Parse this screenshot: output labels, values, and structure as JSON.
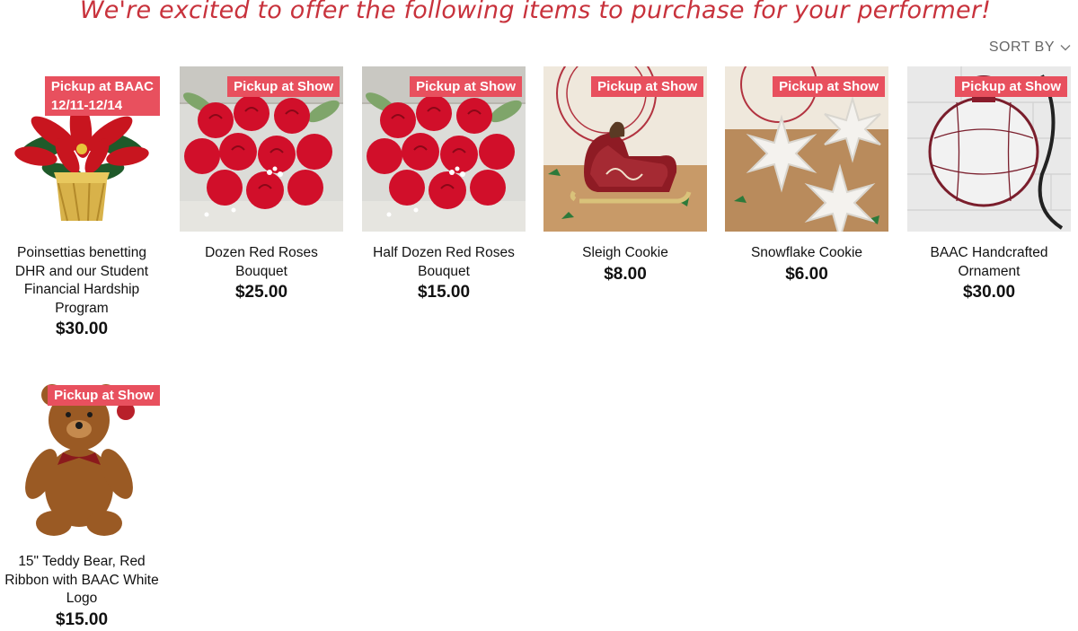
{
  "header": {
    "headline": "We're excited to offer the following items to purchase for your performer!",
    "sort_label": "SORT BY"
  },
  "products": [
    {
      "name": "Poinsettias benetting DHR and our Student Financial Hardship Program",
      "price": "$30.00",
      "badge_line1": "Pickup at BAAC",
      "badge_line2": "12/11-12/14",
      "image": "poinsettia"
    },
    {
      "name": "Dozen Red Roses Bouquet",
      "price": "$25.00",
      "badge_line1": "Pickup at Show",
      "image": "roses"
    },
    {
      "name": "Half Dozen Red Roses Bouquet",
      "price": "$15.00",
      "badge_line1": "Pickup at Show",
      "image": "roses"
    },
    {
      "name": "Sleigh Cookie",
      "price": "$8.00",
      "badge_line1": "Pickup at Show",
      "image": "sleigh-cookie"
    },
    {
      "name": "Snowflake Cookie",
      "price": "$6.00",
      "badge_line1": "Pickup at Show",
      "image": "snowflake-cookie"
    },
    {
      "name": "BAAC Handcrafted Ornament",
      "price": "$30.00",
      "badge_line1": "Pickup at Show",
      "image": "ornament"
    },
    {
      "name": "15\" Teddy Bear, Red Ribbon with BAAC White Logo",
      "price": "$15.00",
      "badge_line1": "Pickup at Show",
      "image": "teddy-bear"
    }
  ],
  "colors": {
    "headline": "#c8323c",
    "badge": "#e8505e"
  }
}
